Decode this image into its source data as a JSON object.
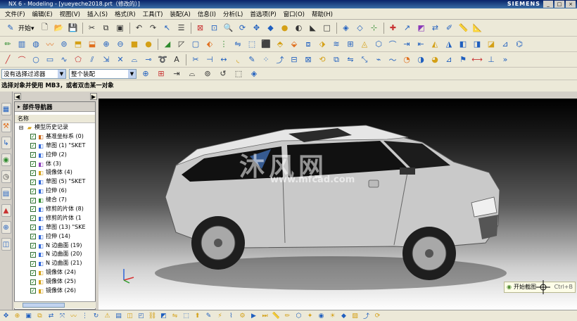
{
  "window": {
    "title": "NX 6 - Modeling - [yueyeche2018.prt（修改的）]",
    "brand": "SIEMENS"
  },
  "menu": [
    "文件(F)",
    "编辑(E)",
    "视图(V)",
    "插入(S)",
    "格式(R)",
    "工具(T)",
    "装配(A)",
    "信息(I)",
    "分析(L)",
    "首选项(P)",
    "窗口(O)",
    "帮助(H)"
  ],
  "toolbar": {
    "start_label": "开始▾"
  },
  "filter": {
    "selection_filter": "没有选择过滤器",
    "assembly_scope": "整个装配"
  },
  "status": {
    "prompt": "选择对象并使用 MB3，或者双击某一对象"
  },
  "navigator": {
    "title": "部件导航器",
    "column_name": "名称",
    "root": "模型历史记录",
    "items": [
      "基准坐标系 (0)",
      "草图 (1) \"SKET",
      "拉伸 (2)",
      "体 (3)",
      "镜像体 (4)",
      "草图 (5) \"SKET",
      "拉伸 (6)",
      "缝合 (7)",
      "修剪的片体 (8)",
      "修剪的片体 (1",
      "草图 (13) \"SKE",
      "拉伸 (14)",
      "N 边曲面 (19)",
      "N 边曲面 (20)",
      "N 边曲面 (21)",
      "镜像体 (24)",
      "镜像体 (25)",
      "镜像体 (26)"
    ]
  },
  "viewport": {
    "watermark": "沐风网",
    "watermark_url": "www.mfcad.com"
  },
  "hint": {
    "label": "开始截图",
    "shortcut": "Ctrl+B"
  }
}
